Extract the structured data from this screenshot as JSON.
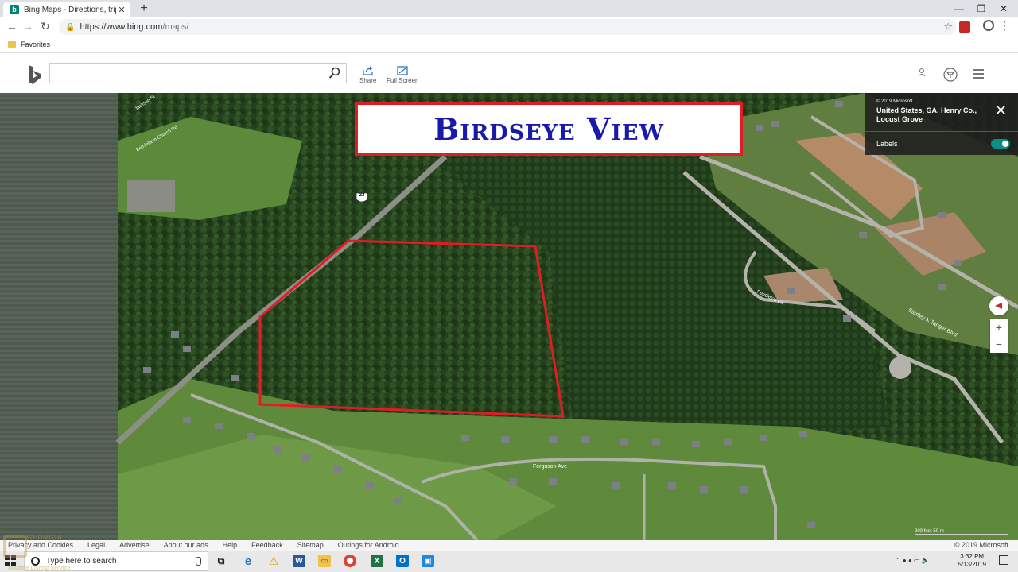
{
  "browser": {
    "tab_title": "Bing Maps - Directions, trip plann",
    "tab_favicon": "b",
    "url_host": "https://www.bing.com",
    "url_path": "/maps/",
    "favorites_label": "Favorites"
  },
  "bing": {
    "share_label": "Share",
    "fullscreen_label": "Full Screen",
    "search_placeholder": ""
  },
  "map": {
    "banner": "Birdseye View",
    "highway_label": "23",
    "street_labels": [
      "Ferguson Ave",
      "Stanley K Tanger Blvd",
      "Pendleton Cir",
      "Jackson St",
      "Bethlehem Church Rd"
    ],
    "info": {
      "copyright": "© 2019 Microsoft",
      "location": "United States, GA, Henry Co., Locust Grove",
      "labels_label": "Labels",
      "labels_on": true
    },
    "zoom_in": "+",
    "zoom_out": "−",
    "scale_text": "200 feet      50 m"
  },
  "footer": {
    "links": [
      "Privacy and Cookies",
      "Legal",
      "Advertise",
      "About our ads",
      "Help",
      "Feedback",
      "Sitemap",
      "Outings for Android"
    ],
    "copyright": "© 2019 Microsoft"
  },
  "taskbar": {
    "search_placeholder": "Type here to search",
    "time": "3:32 PM",
    "date": "5/13/2019"
  },
  "watermark": {
    "line1": "GEORGIA",
    "line2": "Multiple Listing Service"
  },
  "colors": {
    "boundary": "#e01c24",
    "banner_text": "#1a1aaa",
    "toggle": "#0a8f87"
  }
}
